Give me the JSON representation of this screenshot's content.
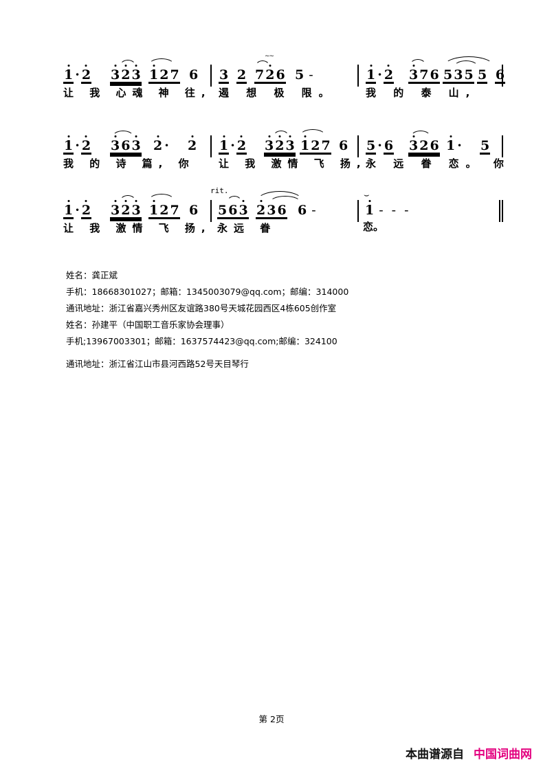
{
  "document": {
    "type": "jianpu-numbered-musical-notation",
    "page_label": "第 2页"
  },
  "systems": [
    {
      "id": "system-1",
      "measures": [
        {
          "id": "m1",
          "notes": [
            {
              "t": "1",
              "oct": "high",
              "beam": 1
            },
            {
              "t": "·"
            },
            {
              "t": "2",
              "oct": "high",
              "beam": 1
            },
            {
              "t": "3",
              "oct": "high",
              "beam": 2
            },
            {
              "t": "2",
              "oct": "high",
              "beam": 2
            },
            {
              "t": "3",
              "oct": "high",
              "beam": 2
            },
            {
              "t": "1",
              "oct": "high",
              "beam": 1
            },
            {
              "t": "2",
              "beam": 1
            },
            {
              "t": "7",
              "beam": 1
            },
            {
              "t": "6",
              "beam": 0
            }
          ],
          "lyric": "让 我  心魂  神    往,"
        },
        {
          "id": "m2",
          "notes": [
            {
              "t": "3",
              "beam": 1
            },
            {
              "t": "2",
              "beam": 1
            },
            {
              "t": "7",
              "beam": 1
            },
            {
              "t": "2",
              "oct": "high",
              "beam": 1
            },
            {
              "t": "6",
              "beam": 1
            },
            {
              "t": "5",
              "beam": 0
            },
            {
              "t": "-"
            }
          ],
          "lyric": "遏 想  极    限。"
        },
        {
          "id": "m3",
          "notes": [
            {
              "t": "1",
              "oct": "high",
              "beam": 1
            },
            {
              "t": "·"
            },
            {
              "t": "2",
              "oct": "high",
              "beam": 1
            },
            {
              "t": "3",
              "oct": "high",
              "beam": 1
            },
            {
              "t": "7",
              "beam": 1
            },
            {
              "t": "6",
              "beam": 1
            },
            {
              "t": "5",
              "beam": 1
            },
            {
              "t": "3",
              "beam": 1
            },
            {
              "t": "5",
              "beam": 1
            },
            {
              "t": "5",
              "beam": 1
            },
            {
              "t": "6",
              "beam": 1
            }
          ],
          "lyric": "我 的 泰   山,"
        }
      ]
    },
    {
      "id": "system-2",
      "measures": [
        {
          "id": "m4",
          "notes": [
            {
              "t": "1",
              "oct": "high",
              "beam": 1
            },
            {
              "t": "·"
            },
            {
              "t": "2",
              "oct": "high",
              "beam": 1
            },
            {
              "t": "3",
              "oct": "high",
              "beam": 2
            },
            {
              "t": "6",
              "beam": 2
            },
            {
              "t": "3",
              "oct": "high",
              "beam": 2
            },
            {
              "t": "2",
              "oct": "high",
              "beam": 0
            },
            {
              "t": "·"
            },
            {
              "t": "2",
              "oct": "high",
              "beam": 0
            }
          ],
          "lyric": "我 的  诗    篇,  你"
        },
        {
          "id": "m5",
          "notes": [
            {
              "t": "1",
              "oct": "high",
              "beam": 1
            },
            {
              "t": "·"
            },
            {
              "t": "2",
              "oct": "high",
              "beam": 1
            },
            {
              "t": "3",
              "oct": "high",
              "beam": 2
            },
            {
              "t": "2",
              "oct": "high",
              "beam": 2
            },
            {
              "t": "3",
              "oct": "high",
              "beam": 2
            },
            {
              "t": "1",
              "oct": "high",
              "beam": 1
            },
            {
              "t": "2",
              "beam": 1
            },
            {
              "t": "7",
              "beam": 1
            },
            {
              "t": "6",
              "beam": 0
            }
          ],
          "lyric": "让 我  激情  飞    扬,"
        },
        {
          "id": "m6",
          "notes": [
            {
              "t": "5",
              "beam": 1
            },
            {
              "t": "·"
            },
            {
              "t": "6",
              "beam": 1
            },
            {
              "t": "3",
              "oct": "high",
              "beam": 2
            },
            {
              "t": "2",
              "beam": 2
            },
            {
              "t": "6",
              "beam": 2
            },
            {
              "t": "1",
              "oct": "high",
              "beam": 0
            },
            {
              "t": "·"
            },
            {
              "t": "5",
              "beam": 1
            }
          ],
          "lyric": "永 远 眷   恋。  你"
        }
      ]
    },
    {
      "id": "system-3",
      "measures": [
        {
          "id": "m7",
          "notes": [
            {
              "t": "1",
              "oct": "high",
              "beam": 1
            },
            {
              "t": "·"
            },
            {
              "t": "2",
              "oct": "high",
              "beam": 1
            },
            {
              "t": "3",
              "oct": "high",
              "beam": 2
            },
            {
              "t": "2",
              "oct": "high",
              "beam": 2
            },
            {
              "t": "3",
              "oct": "high",
              "beam": 2
            },
            {
              "t": "1",
              "oct": "high",
              "beam": 1
            },
            {
              "t": "2",
              "beam": 1
            },
            {
              "t": "7",
              "beam": 1
            },
            {
              "t": "6",
              "beam": 0
            }
          ],
          "lyric": "让 我  激情  飞    扬,"
        },
        {
          "id": "m8",
          "notes": [
            {
              "t": "5",
              "beam": 1
            },
            {
              "t": "6",
              "beam": 1
            },
            {
              "t": "3",
              "oct": "high",
              "beam": 1
            },
            {
              "t": "2",
              "oct": "high",
              "beam": 1
            },
            {
              "t": "3",
              "beam": 1
            },
            {
              "t": "6",
              "beam": 1
            },
            {
              "t": "6",
              "beam": 0
            },
            {
              "t": "-"
            }
          ],
          "lyric": "永远  眷",
          "expression": "rit."
        },
        {
          "id": "m9",
          "notes": [
            {
              "t": "1",
              "oct": "high",
              "fermata": true
            },
            {
              "t": "-"
            },
            {
              "t": "-"
            },
            {
              "t": "-"
            }
          ],
          "lyric": "恋。"
        }
      ]
    }
  ],
  "contact": {
    "lines": [
      "姓名：龚正斌",
      "手机：18668301027；邮箱：1345003079@qq.com；邮编：314000",
      "通讯地址：浙江省嘉兴秀州区友谊路380号天城花园西区4栋605创作室",
      "姓名：孙建平（中国职工音乐家协会理事）",
      "手机;13967003301；邮箱：1637574423@qq.com;邮编：324100",
      "通讯地址：浙江省江山市县河西路52号天目琴行"
    ]
  },
  "footer": {
    "page_label": "第 2页",
    "brand_prefix": "本曲谱源自",
    "brand_name": "中国词曲网",
    "brand_color": "#E3007F"
  }
}
